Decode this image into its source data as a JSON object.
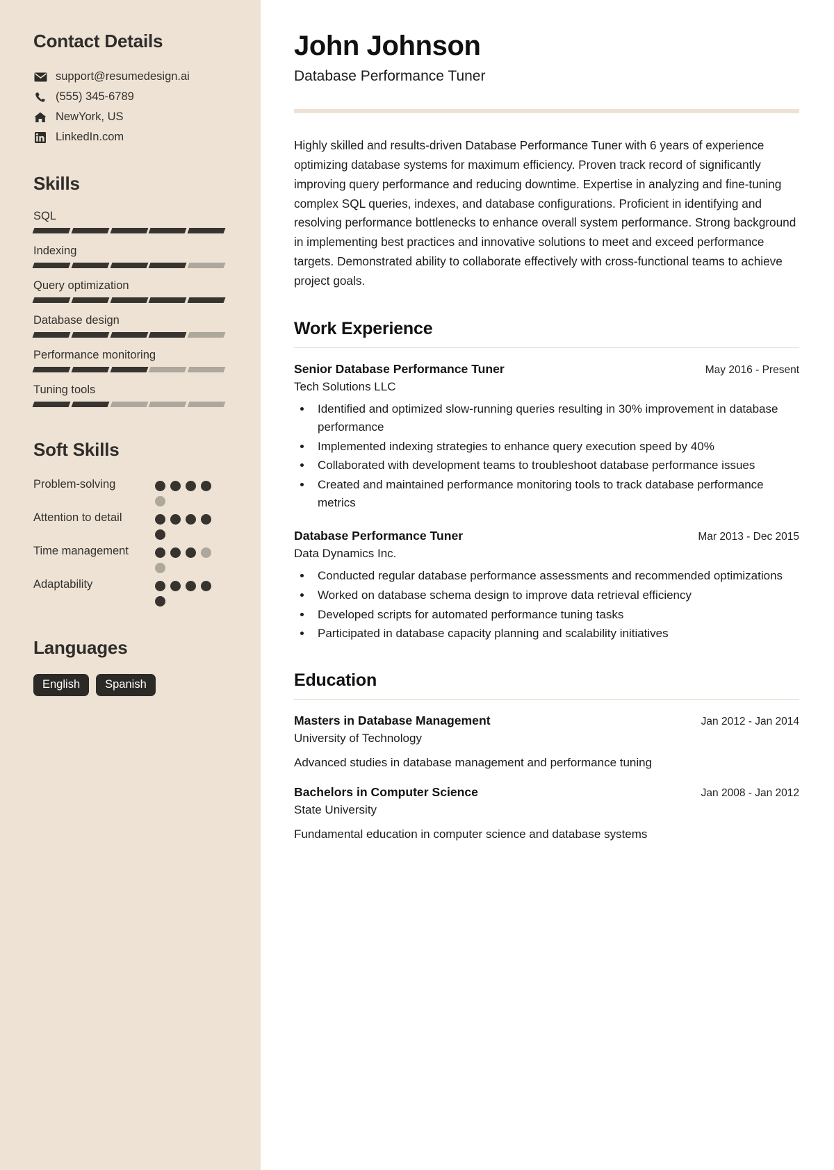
{
  "sidebar": {
    "contact": {
      "heading": "Contact Details",
      "items": [
        {
          "icon": "envelope-icon",
          "value": "support@resumedesign.ai"
        },
        {
          "icon": "phone-icon",
          "value": "(555) 345-6789"
        },
        {
          "icon": "home-icon",
          "value": "NewYork, US"
        },
        {
          "icon": "linkedin-icon",
          "value": "LinkedIn.com"
        }
      ]
    },
    "skills": {
      "heading": "Skills",
      "total_segments": 5,
      "items": [
        {
          "name": "SQL",
          "level": 5
        },
        {
          "name": "Indexing",
          "level": 4
        },
        {
          "name": "Query optimization",
          "level": 5
        },
        {
          "name": "Database design",
          "level": 4
        },
        {
          "name": "Performance monitoring",
          "level": 3
        },
        {
          "name": "Tuning tools",
          "level": 2
        }
      ]
    },
    "soft_skills": {
      "heading": "Soft Skills",
      "total_dots": 5,
      "items": [
        {
          "name": "Problem-solving",
          "level": 4
        },
        {
          "name": "Attention to detail",
          "level": 5
        },
        {
          "name": "Time management",
          "level": 3
        },
        {
          "name": "Adaptability",
          "level": 5
        }
      ]
    },
    "languages": {
      "heading": "Languages",
      "tags": [
        "English",
        "Spanish"
      ]
    }
  },
  "main": {
    "name": "John Johnson",
    "job_title": "Database Performance Tuner",
    "summary": "Highly skilled and results-driven Database Performance Tuner with 6 years of experience optimizing database systems for maximum efficiency. Proven track record of significantly improving query performance and reducing downtime. Expertise in analyzing and fine-tuning complex SQL queries, indexes, and database configurations. Proficient in identifying and resolving performance bottlenecks to enhance overall system performance. Strong background in implementing best practices and innovative solutions to meet and exceed performance targets. Demonstrated ability to collaborate effectively with cross-functional teams to achieve project goals.",
    "work": {
      "heading": "Work Experience",
      "entries": [
        {
          "role": "Senior Database Performance Tuner",
          "date": "May 2016 - Present",
          "org": "Tech Solutions LLC",
          "bullets": [
            "Identified and optimized slow-running queries resulting in 30% improvement in database performance",
            "Implemented indexing strategies to enhance query execution speed by 40%",
            "Collaborated with development teams to troubleshoot database performance issues",
            "Created and maintained performance monitoring tools to track database performance metrics"
          ]
        },
        {
          "role": "Database Performance Tuner",
          "date": "Mar 2013 - Dec 2015",
          "org": "Data Dynamics Inc.",
          "bullets": [
            "Conducted regular database performance assessments and recommended optimizations",
            "Worked on database schema design to improve data retrieval efficiency",
            "Developed scripts for automated performance tuning tasks",
            "Participated in database capacity planning and scalability initiatives"
          ]
        }
      ]
    },
    "education": {
      "heading": "Education",
      "entries": [
        {
          "degree": "Masters in Database Management",
          "date": "Jan 2012 - Jan 2014",
          "school": "University of Technology",
          "description": "Advanced studies in database management and performance tuning"
        },
        {
          "degree": "Bachelors in Computer Science",
          "date": "Jan 2008 - Jan 2012",
          "school": "State University",
          "description": "Fundamental education in computer science and database systems"
        }
      ]
    }
  },
  "colors": {
    "sidebar_bg": "#EDE2D4",
    "accent_dark": "#37342f",
    "accent_muted": "#AEA79B",
    "tag_bg": "#2c2a27"
  }
}
